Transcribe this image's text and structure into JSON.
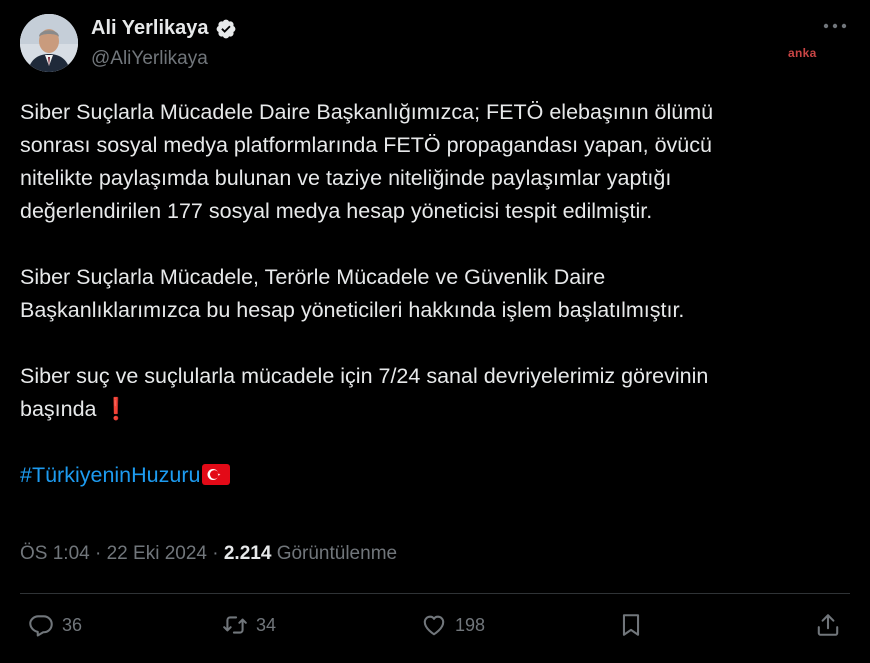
{
  "author": {
    "name": "Ali Yerlikaya",
    "handle": "@AliYerlikaya",
    "verified": true
  },
  "watermark": "anka",
  "tweet": {
    "lines": [
      "Siber Suçlarla Mücadele Daire Başkanlığımızca; FETÖ elebaşının ölümü",
      "sonrası sosyal medya platformlarında FETÖ propagandası yapan, övücü",
      "nitelikte paylaşımda bulunan ve taziye niteliğinde paylaşımlar yaptığı",
      "değerlendirilen 177 sosyal medya hesap yöneticisi tespit edilmiştir.",
      "Siber Suçlarla Mücadele, Terörle Mücadele ve Güvenlik Daire",
      "Başkanlıklarımızca bu hesap yöneticileri hakkında işlem başlatılmıştır.",
      "Siber suç ve suçlularla mücadele için 7/24 sanal devriyelerimiz görevinin",
      "başında"
    ],
    "exclamation": "❗",
    "hashtag": "#TürkiyeninHuzuru"
  },
  "meta": {
    "time": "ÖS 1:04",
    "separator": "·",
    "date": "22 Eki 2024",
    "views": "2.214",
    "views_label": "Görüntülenme"
  },
  "actions": {
    "replies": "36",
    "reposts": "34",
    "likes": "198"
  },
  "colors": {
    "background": "#000000",
    "text": "#e7e9ea",
    "muted": "#71767b",
    "link": "#1d9bf0",
    "verified": "#e7e9ea"
  }
}
